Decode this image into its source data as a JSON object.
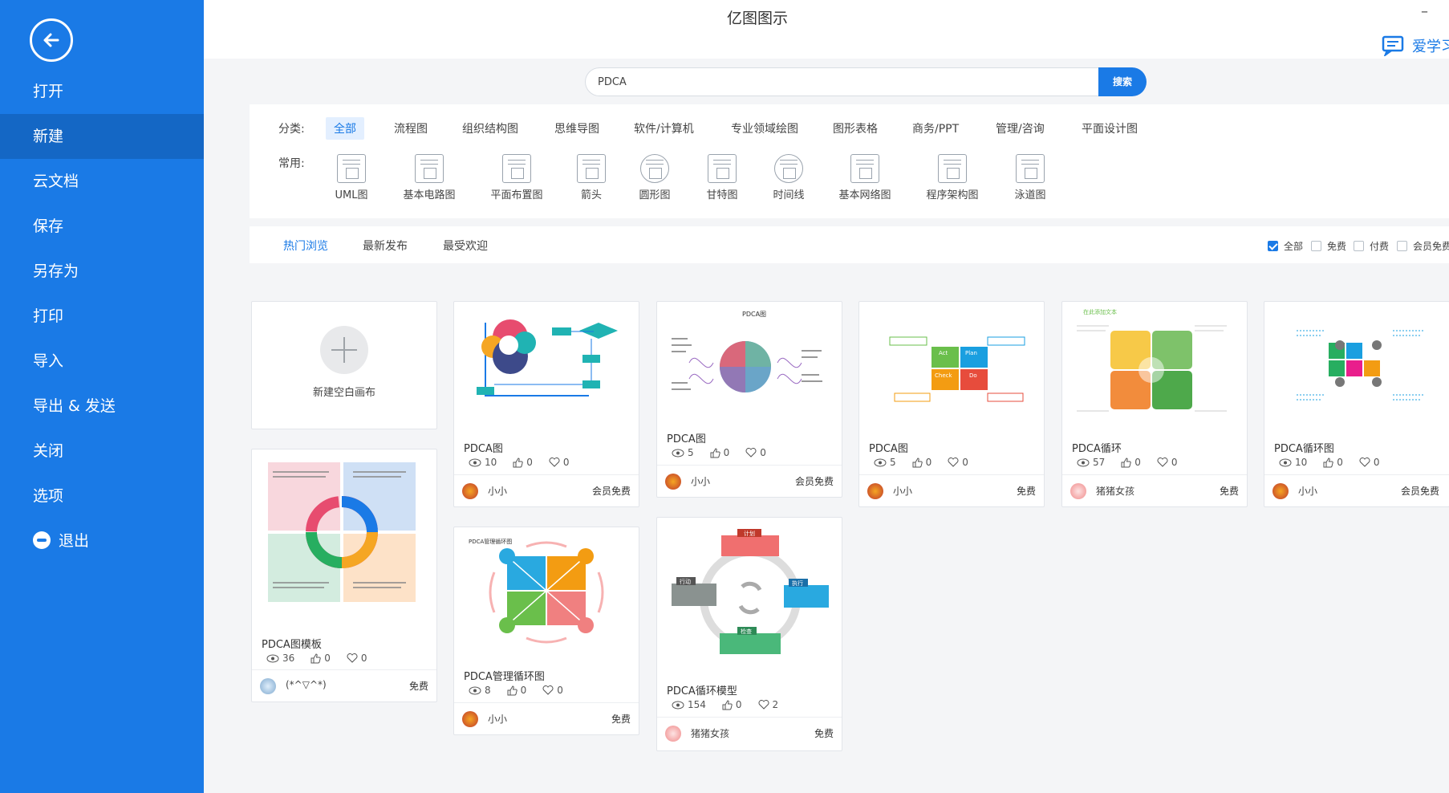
{
  "app": {
    "title": "亿图图示",
    "minimize": "–",
    "help_label": "爱学习"
  },
  "sidebar": {
    "items": [
      {
        "label": "打开"
      },
      {
        "label": "新建",
        "active": true
      },
      {
        "label": "云文档"
      },
      {
        "label": "保存"
      },
      {
        "label": "另存为"
      },
      {
        "label": "打印"
      },
      {
        "label": "导入"
      },
      {
        "label": "导出 & 发送"
      },
      {
        "label": "关闭"
      },
      {
        "label": "选项"
      },
      {
        "label": "退出",
        "icon": "minus-circle-icon"
      }
    ]
  },
  "search": {
    "value": "PDCA",
    "placeholder": "",
    "button_label": "搜索"
  },
  "categories": {
    "label": "分类:",
    "tabs": [
      "全部",
      "流程图",
      "组织结构图",
      "思维导图",
      "软件/计算机",
      "专业领域绘图",
      "图形表格",
      "商务/PPT",
      "管理/咨询",
      "平面设计图"
    ],
    "active_index": 0
  },
  "common": {
    "label": "常用:",
    "items": [
      {
        "label": "UML图",
        "icon": "uml-icon"
      },
      {
        "label": "基本电路图",
        "icon": "circuit-icon"
      },
      {
        "label": "平面布置图",
        "icon": "floorplan-icon"
      },
      {
        "label": "箭头",
        "icon": "arrow-shapes-icon"
      },
      {
        "label": "圆形图",
        "icon": "circle-chart-icon"
      },
      {
        "label": "甘特图",
        "icon": "gantt-icon"
      },
      {
        "label": "时间线",
        "icon": "timeline-icon"
      },
      {
        "label": "基本网络图",
        "icon": "network-icon"
      },
      {
        "label": "程序架构图",
        "icon": "architecture-icon"
      },
      {
        "label": "泳道图",
        "icon": "swimlane-icon"
      }
    ]
  },
  "sort": {
    "tabs": [
      "热门浏览",
      "最新发布",
      "最受欢迎"
    ],
    "active_index": 0,
    "filters": [
      {
        "label": "全部",
        "checked": true
      },
      {
        "label": "免费",
        "checked": false
      },
      {
        "label": "付费",
        "checked": false
      },
      {
        "label": "会员免费",
        "checked": false
      }
    ]
  },
  "blank_card": {
    "label": "新建空白画布"
  },
  "cards": [
    {
      "title": "PDCA图",
      "views": "10",
      "likes": "0",
      "favs": "0",
      "author": "小小",
      "price": "会员免费"
    },
    {
      "title": "PDCA图",
      "views": "5",
      "likes": "0",
      "favs": "0",
      "author": "小小",
      "price": "会员免费"
    },
    {
      "title": "PDCA图",
      "views": "5",
      "likes": "0",
      "favs": "0",
      "author": "小小",
      "price": "免费"
    },
    {
      "title": "PDCA循环",
      "views": "57",
      "likes": "0",
      "favs": "0",
      "author": "猪猪女孩",
      "price": "免费"
    },
    {
      "title": "PDCA循环图",
      "views": "10",
      "likes": "0",
      "favs": "0",
      "author": "小小",
      "price": "会员免费"
    },
    {
      "title": "PDCA图模板",
      "views": "36",
      "likes": "0",
      "favs": "0",
      "author": "(*^▽^*)",
      "price": "免费"
    },
    {
      "title": "PDCA管理循环图",
      "views": "8",
      "likes": "0",
      "favs": "0",
      "author": "小小",
      "price": "免费"
    },
    {
      "title": "PDCA循环模型",
      "views": "154",
      "likes": "0",
      "favs": "2",
      "author": "猪猪女孩",
      "price": "免费"
    }
  ],
  "thumbnails": {
    "card2_header": "PDCA图",
    "card4_header": "在此添加文本",
    "card7_header": "PDCA管理循环图",
    "card8_labels": [
      "计划",
      "执行",
      "检查",
      "行动"
    ],
    "card3_labels": [
      "Act",
      "Plan",
      "Check",
      "Do"
    ]
  },
  "colors": {
    "sidebar": "#1a7ae6",
    "sidebar_active": "#1467c5",
    "accent": "#1a7ae6"
  }
}
